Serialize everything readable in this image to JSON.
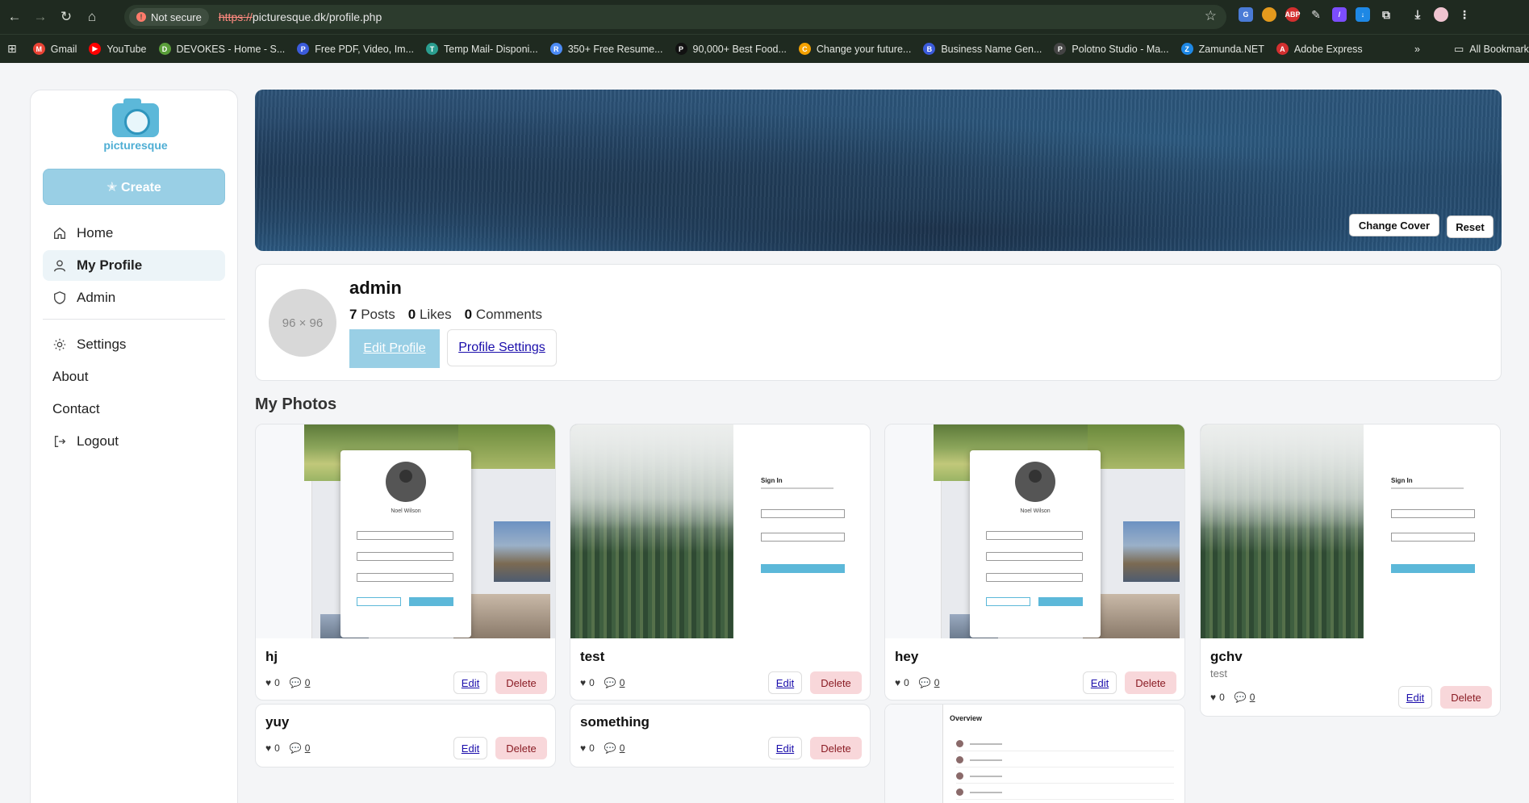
{
  "browser": {
    "security_label": "Not secure",
    "url_scheme": "https://",
    "url_rest": "picturesque.dk/profile.php",
    "bookmarks": [
      {
        "label": "Gmail",
        "color": "#ea4335",
        "glyph": "M"
      },
      {
        "label": "YouTube",
        "color": "#ff0000",
        "glyph": "▶"
      },
      {
        "label": "DEVOKES - Home - S...",
        "color": "#5a9e3a",
        "glyph": "D"
      },
      {
        "label": "Free PDF, Video, Im...",
        "color": "#3b5bdb",
        "glyph": "P"
      },
      {
        "label": "Temp Mail- Disponi...",
        "color": "#2a9d8f",
        "glyph": "T"
      },
      {
        "label": "350+ Free Resume...",
        "color": "#4c8bf5",
        "glyph": "R"
      },
      {
        "label": "90,000+ Best Food...",
        "color": "#111111",
        "glyph": "P"
      },
      {
        "label": "Change your future...",
        "color": "#f4a100",
        "glyph": "C"
      },
      {
        "label": "Business Name Gen...",
        "color": "#3b5bdb",
        "glyph": "B"
      },
      {
        "label": "Polotno Studio - Ma...",
        "color": "#444444",
        "glyph": "P"
      },
      {
        "label": "Zamunda.NET",
        "color": "#1e88e5",
        "glyph": "Z"
      },
      {
        "label": "Adobe Express",
        "color": "#d32f2f",
        "glyph": "A"
      }
    ],
    "all_bookmarks_label": "All Bookmark"
  },
  "sidebar": {
    "logo_text": "picturesque",
    "create_label": "✭ Create",
    "nav": [
      {
        "label": "Home",
        "icon": "home-icon"
      },
      {
        "label": "My Profile",
        "icon": "user-icon",
        "active": true
      },
      {
        "label": "Admin",
        "icon": "shield-icon"
      }
    ],
    "nav_secondary": [
      {
        "label": "Settings",
        "icon": "gear-icon"
      },
      {
        "label": "About"
      },
      {
        "label": "Contact"
      },
      {
        "label": "Logout",
        "icon": "logout-icon"
      }
    ]
  },
  "cover": {
    "change_label": "Change Cover",
    "reset_label": "Reset"
  },
  "profile": {
    "avatar_placeholder": "96 × 96",
    "username": "admin",
    "posts_count": "7",
    "posts_label": "Posts",
    "likes_count": "0",
    "likes_label": "Likes",
    "comments_count": "0",
    "comments_label": "Comments",
    "edit_profile_label": "Edit Profile",
    "profile_settings_label": "Profile Settings"
  },
  "photos": {
    "section_title": "My Photos",
    "edit_label": "Edit",
    "delete_label": "Delete",
    "thumb_texts": {
      "modal_name": "Noel Wilson",
      "sign_in": "Sign In",
      "overview": "Overview"
    },
    "items": [
      {
        "title": "hj",
        "likes": "0",
        "comments": "0"
      },
      {
        "title": "test",
        "likes": "0",
        "comments": "0"
      },
      {
        "title": "hey",
        "likes": "0",
        "comments": "0"
      },
      {
        "title": "gchv",
        "subtitle": "test",
        "likes": "0",
        "comments": "0"
      },
      {
        "title": "yuy",
        "likes": "0",
        "comments": "0"
      },
      {
        "title": "something",
        "likes": "0",
        "comments": "0"
      }
    ]
  },
  "colors": {
    "accent": "#99cfe5",
    "brand": "#4eaed4",
    "delete_bg": "#f8d7da"
  }
}
